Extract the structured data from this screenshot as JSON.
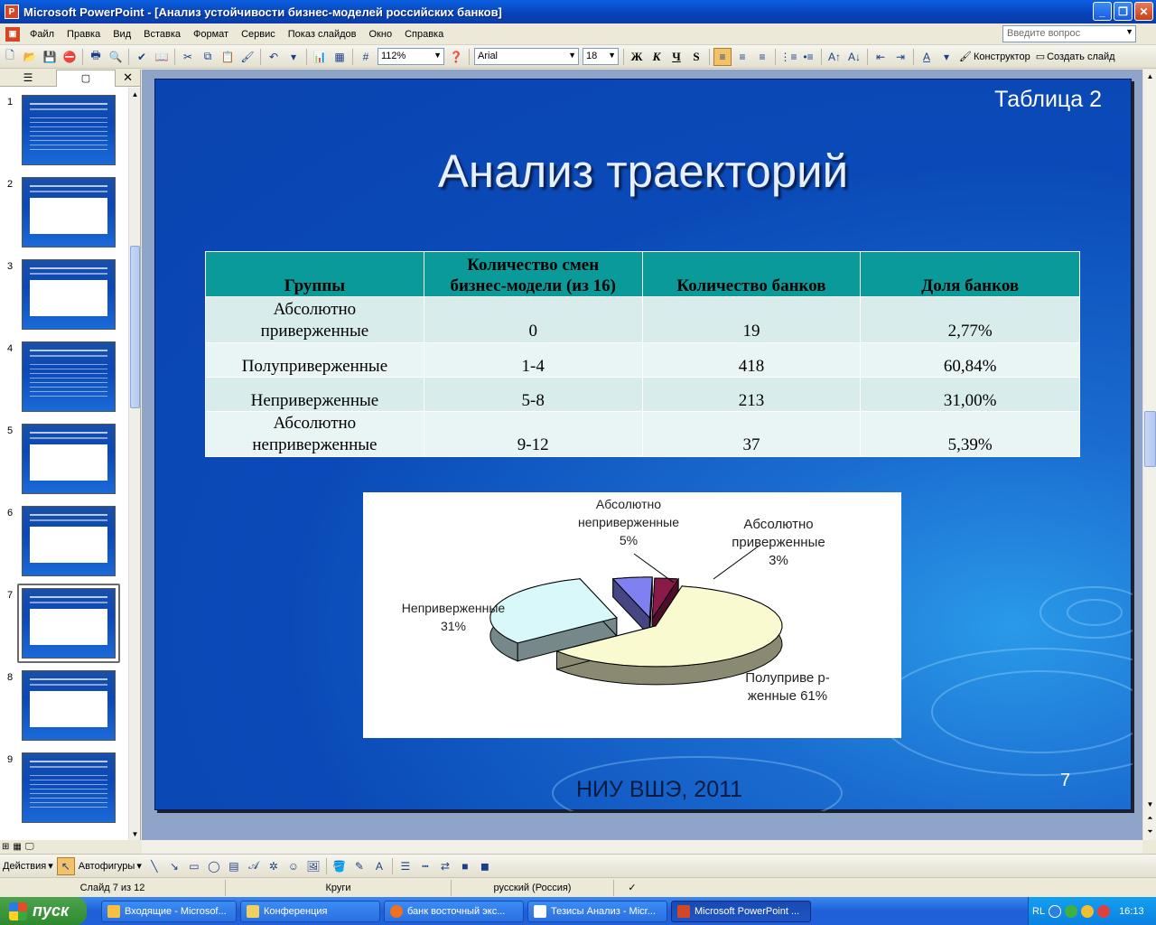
{
  "window": {
    "title": "Microsoft PowerPoint - [Анализ устойчивости бизнес-моделей российских банков]",
    "app_icon": "P",
    "controls": [
      "_",
      "❐",
      "✕"
    ]
  },
  "menu": {
    "items": [
      "Файл",
      "Правка",
      "Вид",
      "Вставка",
      "Формат",
      "Сервис",
      "Показ слайдов",
      "Окно",
      "Справка"
    ],
    "help_placeholder": "Введите вопрос"
  },
  "toolbar": {
    "zoom": "112%",
    "font": "Arial",
    "font_size": "18",
    "bold": "Ж",
    "italic": "К",
    "underline": "Ч",
    "shadow": "S",
    "designer": "Конструктор",
    "new_slide": "Создать слайд"
  },
  "panel": {
    "slide_numbers": [
      "1",
      "2",
      "3",
      "4",
      "5",
      "6",
      "7",
      "8",
      "9"
    ],
    "selected": 7
  },
  "slide": {
    "table_label": "Таблица 2",
    "title": "Анализ траекторий",
    "headers": [
      "Группы",
      "Количество смен бизнес-модели (из 16)",
      "Количество банков",
      "Доля банков"
    ],
    "header_lines": [
      [
        "Группы"
      ],
      [
        "Количество смен",
        "бизнес-модели (из 16)"
      ],
      [
        "Количество банков"
      ],
      [
        "Доля банков"
      ]
    ],
    "rows": [
      {
        "group": "Абсолютно приверженные",
        "group_lines": [
          "Абсолютно",
          "приверженные"
        ],
        "changes": "0",
        "banks": "19",
        "share": "2,77%"
      },
      {
        "group": "Полуприверженные",
        "group_lines": [
          "Полуприверженные"
        ],
        "changes": "1-4",
        "banks": "418",
        "share": "60,84%"
      },
      {
        "group": "Неприверженные",
        "group_lines": [
          "Неприверженные"
        ],
        "changes": "5-8",
        "banks": "213",
        "share": "31,00%"
      },
      {
        "group": "Абсолютно неприверженные",
        "group_lines": [
          "Абсолютно",
          "неприверженные"
        ],
        "changes": "9-12",
        "banks": "37",
        "share": "5,39%"
      }
    ],
    "footer": "НИУ ВШЭ, 2011",
    "slide_number": "7"
  },
  "chart_data": {
    "type": "pie",
    "categories": [
      "Абсолютно приверженные",
      "Полуприверженные",
      "Неприверженные",
      "Абсолютно неприверженные"
    ],
    "values": [
      3,
      61,
      31,
      5
    ],
    "labels": [
      [
        "Абсолютно",
        "приверженные",
        "3%"
      ],
      [
        "Полуприве р-",
        "женные 61%"
      ],
      [
        "Неприверженные",
        "31%"
      ],
      [
        "Абсолютно",
        "неприверженные",
        "5%"
      ]
    ],
    "colors": [
      "#8a1a4a",
      "#fafad0",
      "#d8f8fa",
      "#8080f0"
    ],
    "exploded": true,
    "three_d": true
  },
  "drawing": {
    "actions": "Действия",
    "autoshapes": "Автофигуры"
  },
  "status": {
    "slide": "Слайд 7 из 12",
    "design": "Круги",
    "language": "русский (Россия)"
  },
  "taskbar": {
    "start": "пуск",
    "tasks": [
      "Входящие - Microsof...",
      "Конференция",
      "банк восточный экс...",
      "Тезисы Анализ - Micr...",
      "Microsoft PowerPoint ..."
    ],
    "lang": "RL",
    "clock": "16:13"
  }
}
